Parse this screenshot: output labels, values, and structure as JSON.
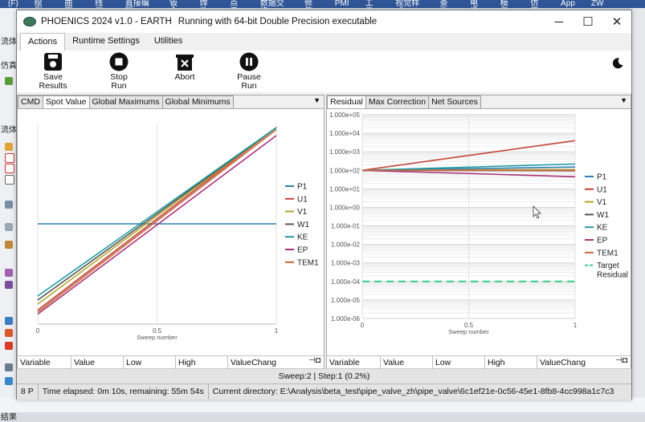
{
  "background": {
    "menu": [
      "(F)",
      "绘型",
      "曲面",
      "线框",
      "直接编辑",
      "钣金",
      "焊件",
      "点云",
      "数据交换",
      "修复",
      "PMI",
      "工具",
      "视觉样式",
      "查询",
      "电极",
      "模具",
      "仿真",
      "App",
      "ZW Teammate"
    ],
    "left_labels": [
      "流体",
      "仿真",
      "流体",
      "结果"
    ]
  },
  "window": {
    "title": "PHOENICS 2024 v1.0 - EARTH",
    "subtitle": "Running with 64-bit Double Precision executable",
    "minimize": "─",
    "maximize": "☐",
    "close": "✕"
  },
  "tabs": [
    "Actions",
    "Runtime Settings",
    "Utilities"
  ],
  "toolbar": {
    "save_l1": "Save",
    "save_l2": "Results",
    "stop_l1": "Stop",
    "stop_l2": "Run",
    "abort": "Abort",
    "pause_l1": "Pause",
    "pause_l2": "Run"
  },
  "left_pane": {
    "tabs": [
      "CMD",
      "Spot Value",
      "Global Maximums",
      "Global Minimums"
    ],
    "grid": [
      "Variable",
      "Value",
      "Low",
      "High",
      "ValueChang"
    ]
  },
  "right_pane": {
    "tabs": [
      "Residual",
      "Max Correction",
      "Net Sources"
    ],
    "grid": [
      "Variable",
      "Value",
      "Low",
      "High",
      "ValueChang"
    ]
  },
  "status": {
    "sweep": "Sweep:2 | Step:1  (0.2%)",
    "p": "8 P",
    "time": "Time elapsed: 0m 10s, remaining: 55m 54s",
    "dir": "Current directory:  E:\\Analysis\\beta_test\\pipe_valve_zh\\pipe_valve\\6c1ef21e-0c56-45e1-8fb8-4cc998a1c7c3"
  },
  "chart_data": [
    {
      "type": "line",
      "name_ref": "spot-value",
      "x": [
        0,
        1
      ],
      "xticks": [
        "0",
        "0.5",
        "1"
      ],
      "xlabel": "Sweep number",
      "xlim": [
        0,
        1
      ],
      "colors": {
        "P1": "#2e7fb5",
        "U1": "#c0453a",
        "V1": "#b5a52d",
        "W1": "#555555",
        "KE": "#1e9aa5",
        "EP": "#a8327a",
        "TEM1": "#c9653c"
      },
      "series": [
        {
          "name": "P1",
          "values": [
            0.5,
            0.5
          ]
        },
        {
          "name": "U1",
          "values": [
            0.07,
            0.98
          ]
        },
        {
          "name": "V1",
          "values": [
            0.1,
            0.98
          ]
        },
        {
          "name": "W1",
          "values": [
            0.12,
            0.98
          ]
        },
        {
          "name": "KE",
          "values": [
            0.14,
            0.98
          ]
        },
        {
          "name": "EP",
          "values": [
            0.05,
            0.94
          ]
        },
        {
          "name": "TEM1",
          "values": [
            0.06,
            0.97
          ]
        }
      ]
    },
    {
      "type": "line",
      "name_ref": "residual",
      "x": [
        0,
        1
      ],
      "xticks": [
        "0",
        "0.5",
        "1"
      ],
      "xlabel": "Sweep number",
      "xlim": [
        0,
        1
      ],
      "log_y": true,
      "yticks": [
        "1.000e+05",
        "1.000e+04",
        "1.000e+03",
        "1.000e+02",
        "1.000e+01",
        "1.000e+00",
        "1.000e-01",
        "1.000e-02",
        "1.000e-03",
        "1.000e-04",
        "1.000e-05",
        "1.000e-06"
      ],
      "ylim_exp": [
        -6,
        5
      ],
      "colors": {
        "P1": "#2e7fb5",
        "U1": "#c0453a",
        "V1": "#b5a52d",
        "W1": "#555555",
        "KE": "#1e9aa5",
        "EP": "#a8327a",
        "TEM1": "#c9653c",
        "Target Residual": "#3ecf8e"
      },
      "series": [
        {
          "name": "P1",
          "values": [
            100,
            150
          ]
        },
        {
          "name": "U1",
          "values": [
            100,
            4000
          ]
        },
        {
          "name": "V1",
          "values": [
            100,
            110
          ]
        },
        {
          "name": "W1",
          "values": [
            100,
            95
          ]
        },
        {
          "name": "KE",
          "values": [
            100,
            220
          ]
        },
        {
          "name": "EP",
          "values": [
            100,
            45
          ]
        },
        {
          "name": "TEM1",
          "values": [
            100,
            100
          ]
        },
        {
          "name": "Target Residual",
          "values": [
            0.0001,
            0.0001
          ],
          "dashed": true
        }
      ]
    }
  ]
}
